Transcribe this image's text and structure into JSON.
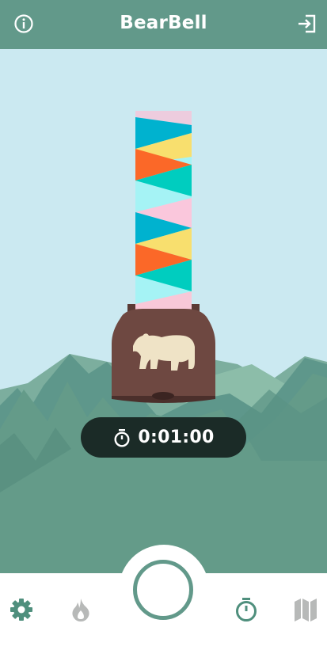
{
  "header": {
    "title": "BearBell",
    "info_icon": "info-icon",
    "login_icon": "login-icon"
  },
  "timer": {
    "value": "0:01:00",
    "icon": "stopwatch-icon"
  },
  "bottom_nav": {
    "items": [
      {
        "icon": "gear-icon",
        "active": true
      },
      {
        "icon": "flame-icon",
        "active": false
      },
      {
        "icon": "record-button",
        "active": false
      },
      {
        "icon": "stopwatch-icon",
        "active": true
      },
      {
        "icon": "map-icon",
        "active": false
      }
    ]
  },
  "colors": {
    "header": "#62998a",
    "sky": "#cbe9f1",
    "mountains": "#649b89",
    "bell": "#6e4841",
    "timer_bg": "#1b2b27",
    "nav_active": "#4f8f7d",
    "nav_inactive": "#b7b9b8"
  }
}
